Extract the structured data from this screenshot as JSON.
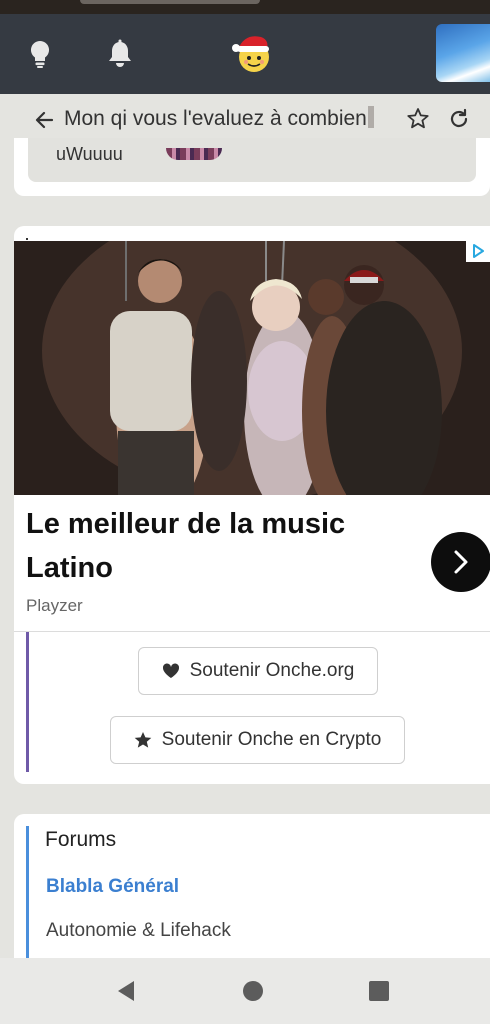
{
  "topbar": {
    "icons": [
      "lightbulb-icon",
      "bell-icon",
      "santa-emoji-icon",
      "avatar"
    ],
    "background": "#353a42"
  },
  "titlebar": {
    "title": "Mon qi vous l'evaluez à combien"
  },
  "post_preview": {
    "username": "uWuuuu"
  },
  "ad": {
    "title": "Le meilleur de la music Latino",
    "brand": "Playzer"
  },
  "support": {
    "support_label": "Soutenir Onche.org",
    "crypto_label": "Soutenir Onche en Crypto"
  },
  "forums": {
    "title": "Forums",
    "items": [
      {
        "label": "Blabla Général",
        "active": true
      },
      {
        "label": "Autonomie & Lifehack",
        "active": false
      }
    ]
  },
  "colors": {
    "accent_blue": "#3b7fd0",
    "accent_purple": "#6f5aa8"
  }
}
